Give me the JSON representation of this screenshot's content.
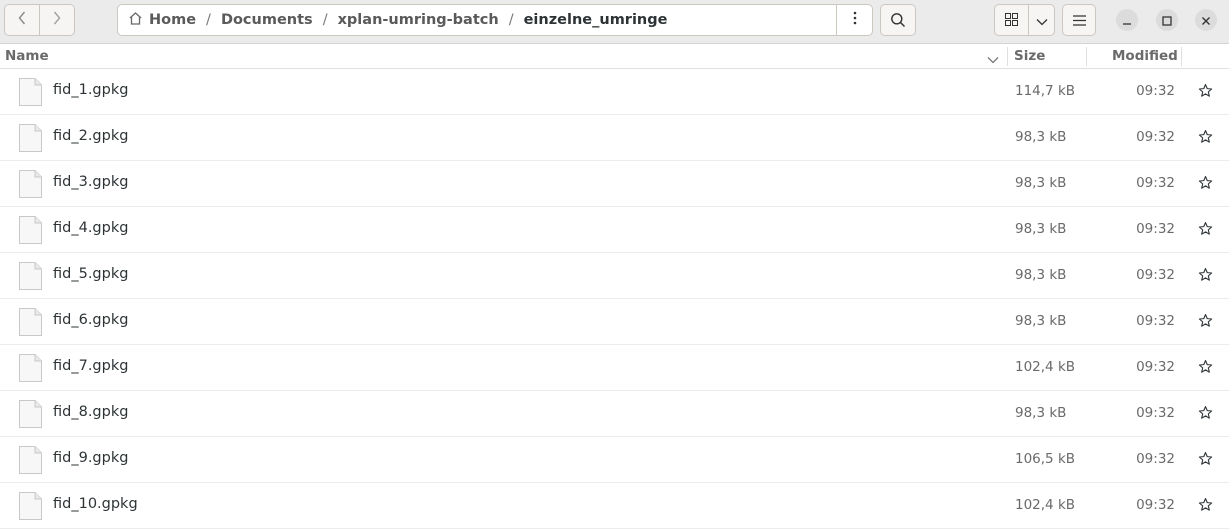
{
  "pathbar": {
    "home": "Home",
    "crumbs": [
      "Documents",
      "xplan-umring-batch"
    ],
    "current": "einzelne_umringe",
    "separator": "/"
  },
  "columns": {
    "name": "Name",
    "size": "Size",
    "modified": "Modified"
  },
  "files": [
    {
      "name": "fid_1.gpkg",
      "size": "114,7 kB",
      "modified": "09:32"
    },
    {
      "name": "fid_2.gpkg",
      "size": "98,3 kB",
      "modified": "09:32"
    },
    {
      "name": "fid_3.gpkg",
      "size": "98,3 kB",
      "modified": "09:32"
    },
    {
      "name": "fid_4.gpkg",
      "size": "98,3 kB",
      "modified": "09:32"
    },
    {
      "name": "fid_5.gpkg",
      "size": "98,3 kB",
      "modified": "09:32"
    },
    {
      "name": "fid_6.gpkg",
      "size": "98,3 kB",
      "modified": "09:32"
    },
    {
      "name": "fid_7.gpkg",
      "size": "102,4 kB",
      "modified": "09:32"
    },
    {
      "name": "fid_8.gpkg",
      "size": "98,3 kB",
      "modified": "09:32"
    },
    {
      "name": "fid_9.gpkg",
      "size": "106,5 kB",
      "modified": "09:32"
    },
    {
      "name": "fid_10.gpkg",
      "size": "102,4 kB",
      "modified": "09:32"
    }
  ],
  "icons": {
    "back": "chevron-left-icon",
    "forward": "chevron-right-icon",
    "home": "home-icon",
    "path_menu": "vertical-dots-icon",
    "search": "search-icon",
    "view": "grid-icon",
    "view_dropdown": "chevron-down-icon",
    "main_menu": "hamburger-icon",
    "minimize": "minimize-icon",
    "maximize": "maximize-icon",
    "close": "close-icon",
    "sort": "chevron-down-icon",
    "file": "file-icon",
    "star": "star-icon"
  }
}
